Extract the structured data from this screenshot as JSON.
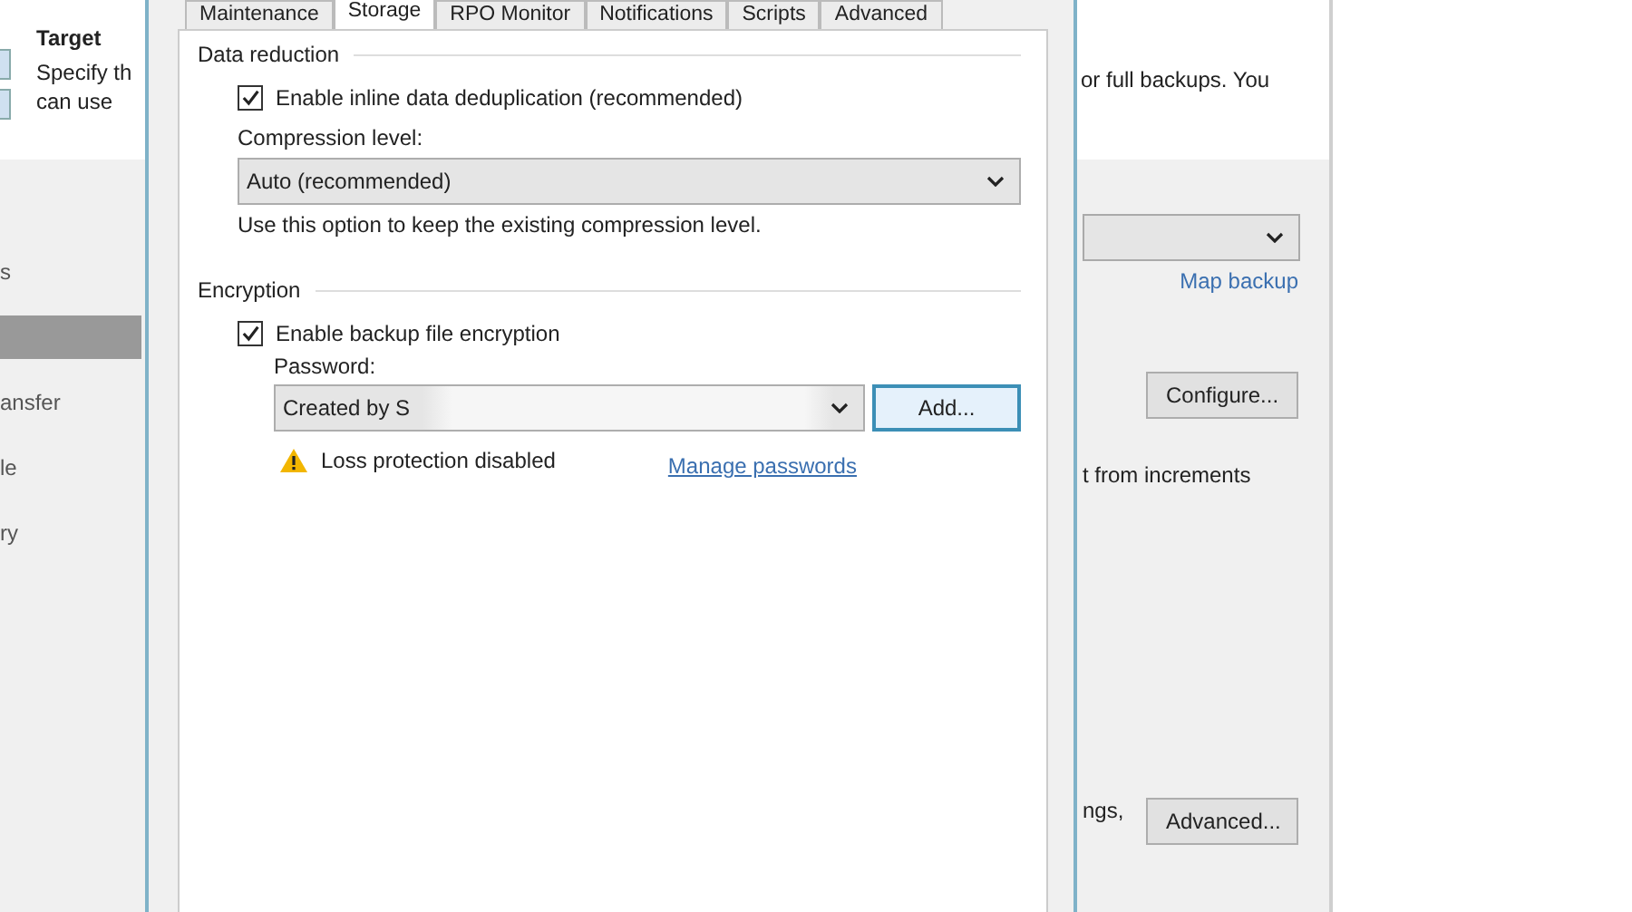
{
  "background_window": {
    "header": {
      "title": "Target",
      "description_lines": [
        "Specify th",
        "can use"
      ],
      "description_right": "or full backups. You"
    },
    "nav_items": [
      {
        "label": "s",
        "selected": false
      },
      {
        "selected": true
      },
      {
        "label": "ansfer",
        "selected": false
      },
      {
        "label": "le",
        "selected": false
      },
      {
        "label": "ry",
        "selected": false
      }
    ],
    "map_backup_link": "Map backup",
    "configure_button": "Configure...",
    "increments_text": "t from increments",
    "settings_text": "ngs,",
    "advanced_button": "Advanced..."
  },
  "dialog": {
    "tabs": [
      {
        "label": "Maintenance",
        "selected": false
      },
      {
        "label": "Storage",
        "selected": true
      },
      {
        "label": "RPO Monitor",
        "selected": false
      },
      {
        "label": "Notifications",
        "selected": false
      },
      {
        "label": "Scripts",
        "selected": false
      },
      {
        "label": "Advanced",
        "selected": false
      }
    ],
    "data_reduction": {
      "title": "Data reduction",
      "dedup": {
        "label": "Enable inline data deduplication (recommended)",
        "checked": true
      },
      "compression_label": "Compression level:",
      "compression_value": "Auto (recommended)",
      "compression_hint": "Use this option to keep the existing compression level."
    },
    "encryption": {
      "title": "Encryption",
      "enable": {
        "label": "Enable backup file encryption",
        "checked": true
      },
      "password_label": "Password:",
      "password_value": "Created by S",
      "add_button": "Add...",
      "warning": "Loss protection disabled",
      "manage_link": "Manage passwords"
    }
  }
}
